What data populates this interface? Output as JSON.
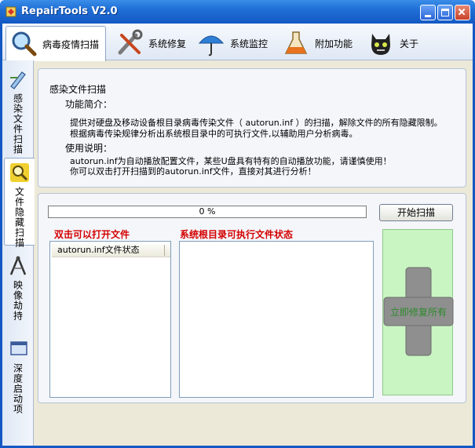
{
  "window": {
    "title": "RepairTools V2.0"
  },
  "top_tabs": [
    {
      "label": "病毒疫情扫描",
      "icon": "magnifier-icon",
      "active": true
    },
    {
      "label": "系统修复",
      "icon": "tools-icon",
      "active": false
    },
    {
      "label": "系统监控",
      "icon": "umbrella-icon",
      "active": false
    },
    {
      "label": "附加功能",
      "icon": "flask-icon",
      "active": false
    },
    {
      "label": "关于",
      "icon": "cat-icon",
      "active": false
    }
  ],
  "side_tabs": [
    {
      "label": "感染文件扫描",
      "icon": "pen-icon",
      "active": false
    },
    {
      "label": "文件隐藏扫描",
      "icon": "magnifier-icon",
      "active": true
    },
    {
      "label": "映像劫持",
      "icon": "compass-icon",
      "active": false
    },
    {
      "label": "深度启动项",
      "icon": "window-icon",
      "active": false
    }
  ],
  "info": {
    "title": "感染文件扫描",
    "intro_heading": "功能简介：",
    "intro_line1": "提供对硬盘及移动设备根目录病毒传染文件（ autorun.inf ）的扫描，解除文件的所有隐藏限制。",
    "intro_line2": "根据病毒传染规律分析出系统根目录中的可执行文件,以辅助用户分析病毒。",
    "usage_heading": "使用说明：",
    "usage_line1": "autorun.inf为自动播放配置文件，某些U盘具有特有的自动播放功能，请谨慎使用！",
    "usage_line2": "你可以双击打开扫描到的autorun.inf文件，直接对其进行分析！"
  },
  "scan": {
    "progress_percent": 0,
    "progress_text": "0 %",
    "start_button": "开始扫描",
    "left_list_header": "双击可以打开文件",
    "left_column_header": "autorun.inf文件状态",
    "right_list_header": "系统根目录可执行文件状态",
    "repair_all": "立即修复所有"
  },
  "colors": {
    "titlebar": "#1f6fd6",
    "header_red": "#d40000",
    "repair_green_bg": "#c9f5c2",
    "repair_text": "#2d8a2d"
  }
}
